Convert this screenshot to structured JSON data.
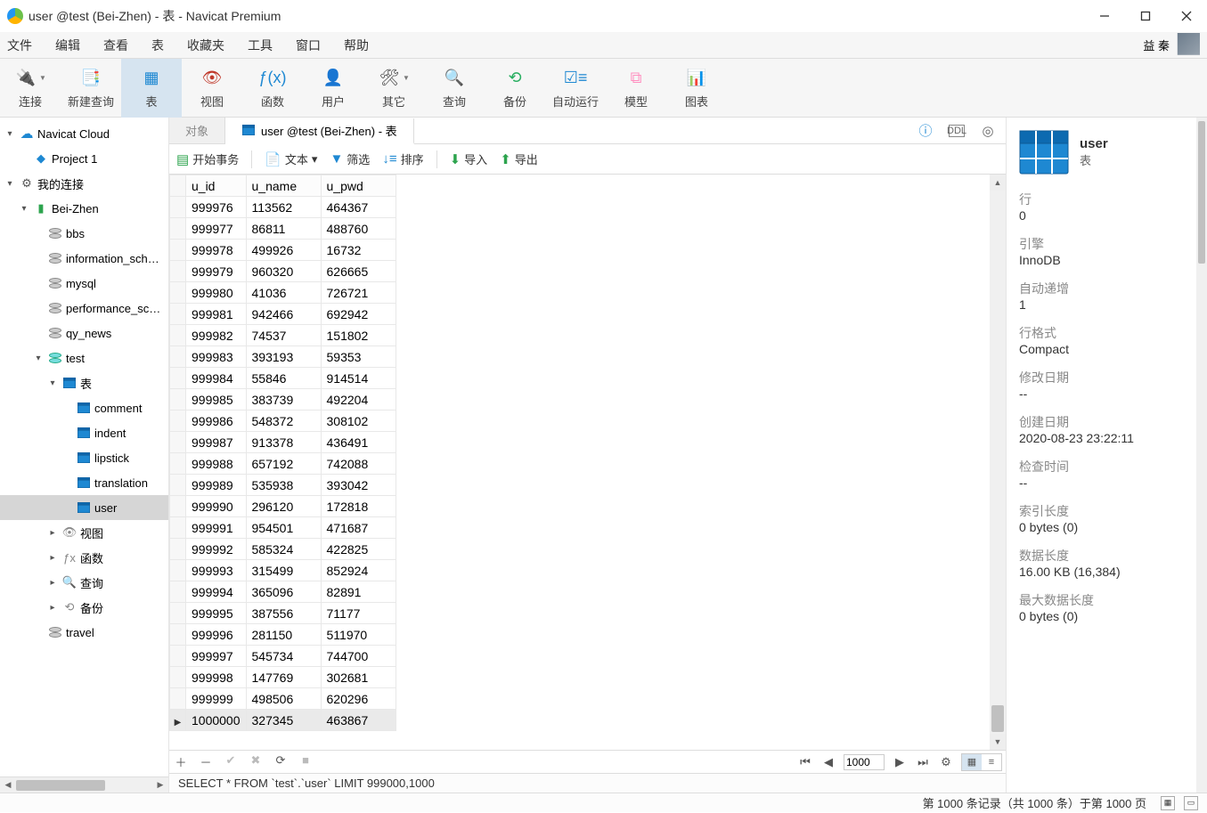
{
  "window": {
    "title": "user @test (Bei-Zhen) - 表 - Navicat Premium"
  },
  "menubar": {
    "items": [
      "文件",
      "编辑",
      "查看",
      "表",
      "收藏夹",
      "工具",
      "窗口",
      "帮助"
    ],
    "user": "益 秦"
  },
  "toolbar": [
    {
      "label": "连接",
      "icon": "plug",
      "color": "ico-blue",
      "drop": true
    },
    {
      "label": "新建查询",
      "icon": "doc-plus",
      "color": "ico-blue"
    },
    {
      "label": "表",
      "icon": "table",
      "color": "ico-blue",
      "active": true
    },
    {
      "label": "视图",
      "icon": "view",
      "color": "ico-red"
    },
    {
      "label": "函数",
      "icon": "fx",
      "color": "ico-blue"
    },
    {
      "label": "用户",
      "icon": "user",
      "color": "ico-orange"
    },
    {
      "label": "其它",
      "icon": "wrench",
      "color": "",
      "drop": true
    },
    {
      "label": "查询",
      "icon": "query",
      "color": "ico-red"
    },
    {
      "label": "备份",
      "icon": "backup",
      "color": "ico-green"
    },
    {
      "label": "自动运行",
      "icon": "auto",
      "color": "ico-blue"
    },
    {
      "label": "模型",
      "icon": "model",
      "color": "ico-pink"
    },
    {
      "label": "图表",
      "icon": "chart",
      "color": "ico-orange"
    }
  ],
  "sidebar": {
    "cloud": "Navicat Cloud",
    "project": "Project 1",
    "my_conn": "我的连接",
    "conn": "Bei-Zhen",
    "dbs": [
      "bbs",
      "information_schema",
      "mysql",
      "performance_schema",
      "qy_news"
    ],
    "test_db": "test",
    "tables_node": "表",
    "tables": [
      "comment",
      "indent",
      "lipstick",
      "translation",
      "user"
    ],
    "other_nodes": [
      "视图",
      "函数",
      "查询",
      "备份"
    ],
    "travel_db": "travel"
  },
  "tabs": {
    "obj": "对象",
    "active": "user @test (Bei-Zhen) - 表"
  },
  "table_toolbar": {
    "begin": "开始事务",
    "text": "文本",
    "filter": "筛选",
    "sort": "排序",
    "import_": "导入",
    "export_": "导出"
  },
  "grid": {
    "columns": [
      "u_id",
      "u_name",
      "u_pwd"
    ],
    "rows": [
      [
        "999976",
        "113562",
        "464367"
      ],
      [
        "999977",
        "86811",
        "488760"
      ],
      [
        "999978",
        "499926",
        "16732"
      ],
      [
        "999979",
        "960320",
        "626665"
      ],
      [
        "999980",
        "41036",
        "726721"
      ],
      [
        "999981",
        "942466",
        "692942"
      ],
      [
        "999982",
        "74537",
        "151802"
      ],
      [
        "999983",
        "393193",
        "59353"
      ],
      [
        "999984",
        "55846",
        "914514"
      ],
      [
        "999985",
        "383739",
        "492204"
      ],
      [
        "999986",
        "548372",
        "308102"
      ],
      [
        "999987",
        "913378",
        "436491"
      ],
      [
        "999988",
        "657192",
        "742088"
      ],
      [
        "999989",
        "535938",
        "393042"
      ],
      [
        "999990",
        "296120",
        "172818"
      ],
      [
        "999991",
        "954501",
        "471687"
      ],
      [
        "999992",
        "585324",
        "422825"
      ],
      [
        "999993",
        "315499",
        "852924"
      ],
      [
        "999994",
        "365096",
        "82891"
      ],
      [
        "999995",
        "387556",
        "71177"
      ],
      [
        "999996",
        "281150",
        "511970"
      ],
      [
        "999997",
        "545734",
        "744700"
      ],
      [
        "999998",
        "147769",
        "302681"
      ],
      [
        "999999",
        "498506",
        "620296"
      ],
      [
        "1000000",
        "327345",
        "463867"
      ]
    ],
    "pager_value": "1000"
  },
  "rpanel": {
    "title": "user",
    "subtitle": "表",
    "fields": [
      {
        "label": "行",
        "value": "0"
      },
      {
        "label": "引擎",
        "value": "InnoDB"
      },
      {
        "label": "自动递增",
        "value": "1"
      },
      {
        "label": "行格式",
        "value": "Compact"
      },
      {
        "label": "修改日期",
        "value": "--"
      },
      {
        "label": "创建日期",
        "value": "2020-08-23 23:22:11"
      },
      {
        "label": "检查时间",
        "value": "--"
      },
      {
        "label": "索引长度",
        "value": "0 bytes (0)"
      },
      {
        "label": "数据长度",
        "value": "16.00 KB (16,384)"
      },
      {
        "label": "最大数据长度",
        "value": "0 bytes (0)"
      }
    ]
  },
  "sql_status": "SELECT * FROM `test`.`user` LIMIT 999000,1000",
  "status": "第 1000 条记录（共 1000 条）于第 1000 页"
}
